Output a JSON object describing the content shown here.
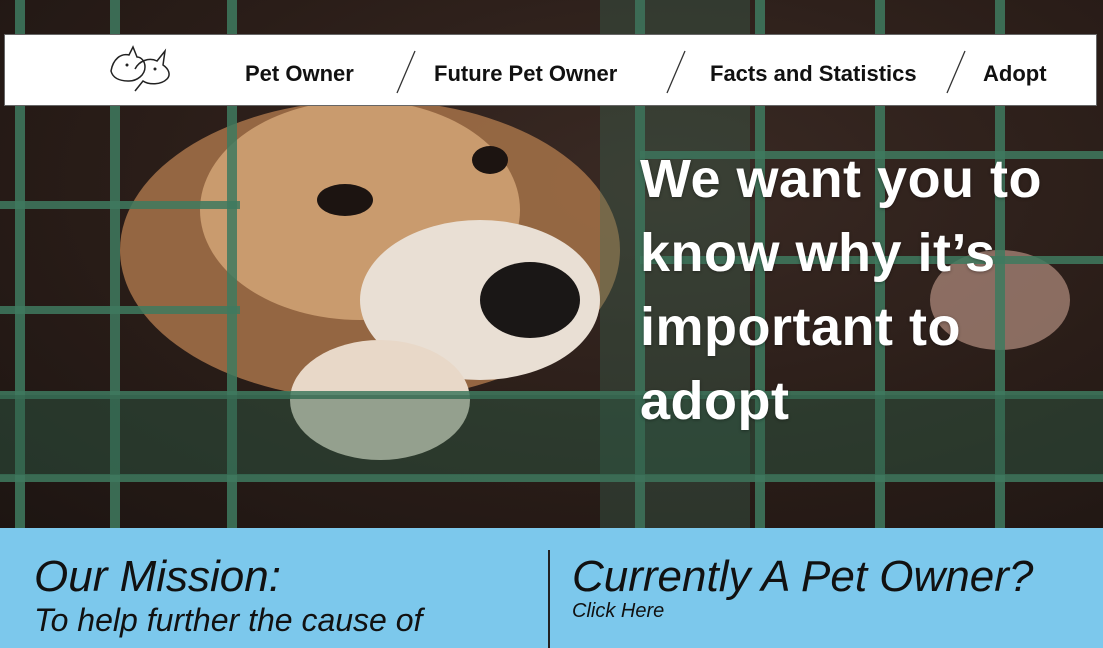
{
  "nav": {
    "items": [
      "Pet Owner",
      "Future Pet Owner",
      "Facts and Statistics",
      "Adopt"
    ]
  },
  "hero": {
    "headline_lines": [
      "We want you to",
      "know why it’s",
      "important to",
      "adopt"
    ]
  },
  "mission": {
    "title": "Our Mission:",
    "text": "To help further the cause of"
  },
  "owner": {
    "title": "Currently A Pet Owner?",
    "link": "Click Here"
  },
  "colors": {
    "panel_bg": "#7cc8ec",
    "cage_green": "#3f7a5f"
  }
}
